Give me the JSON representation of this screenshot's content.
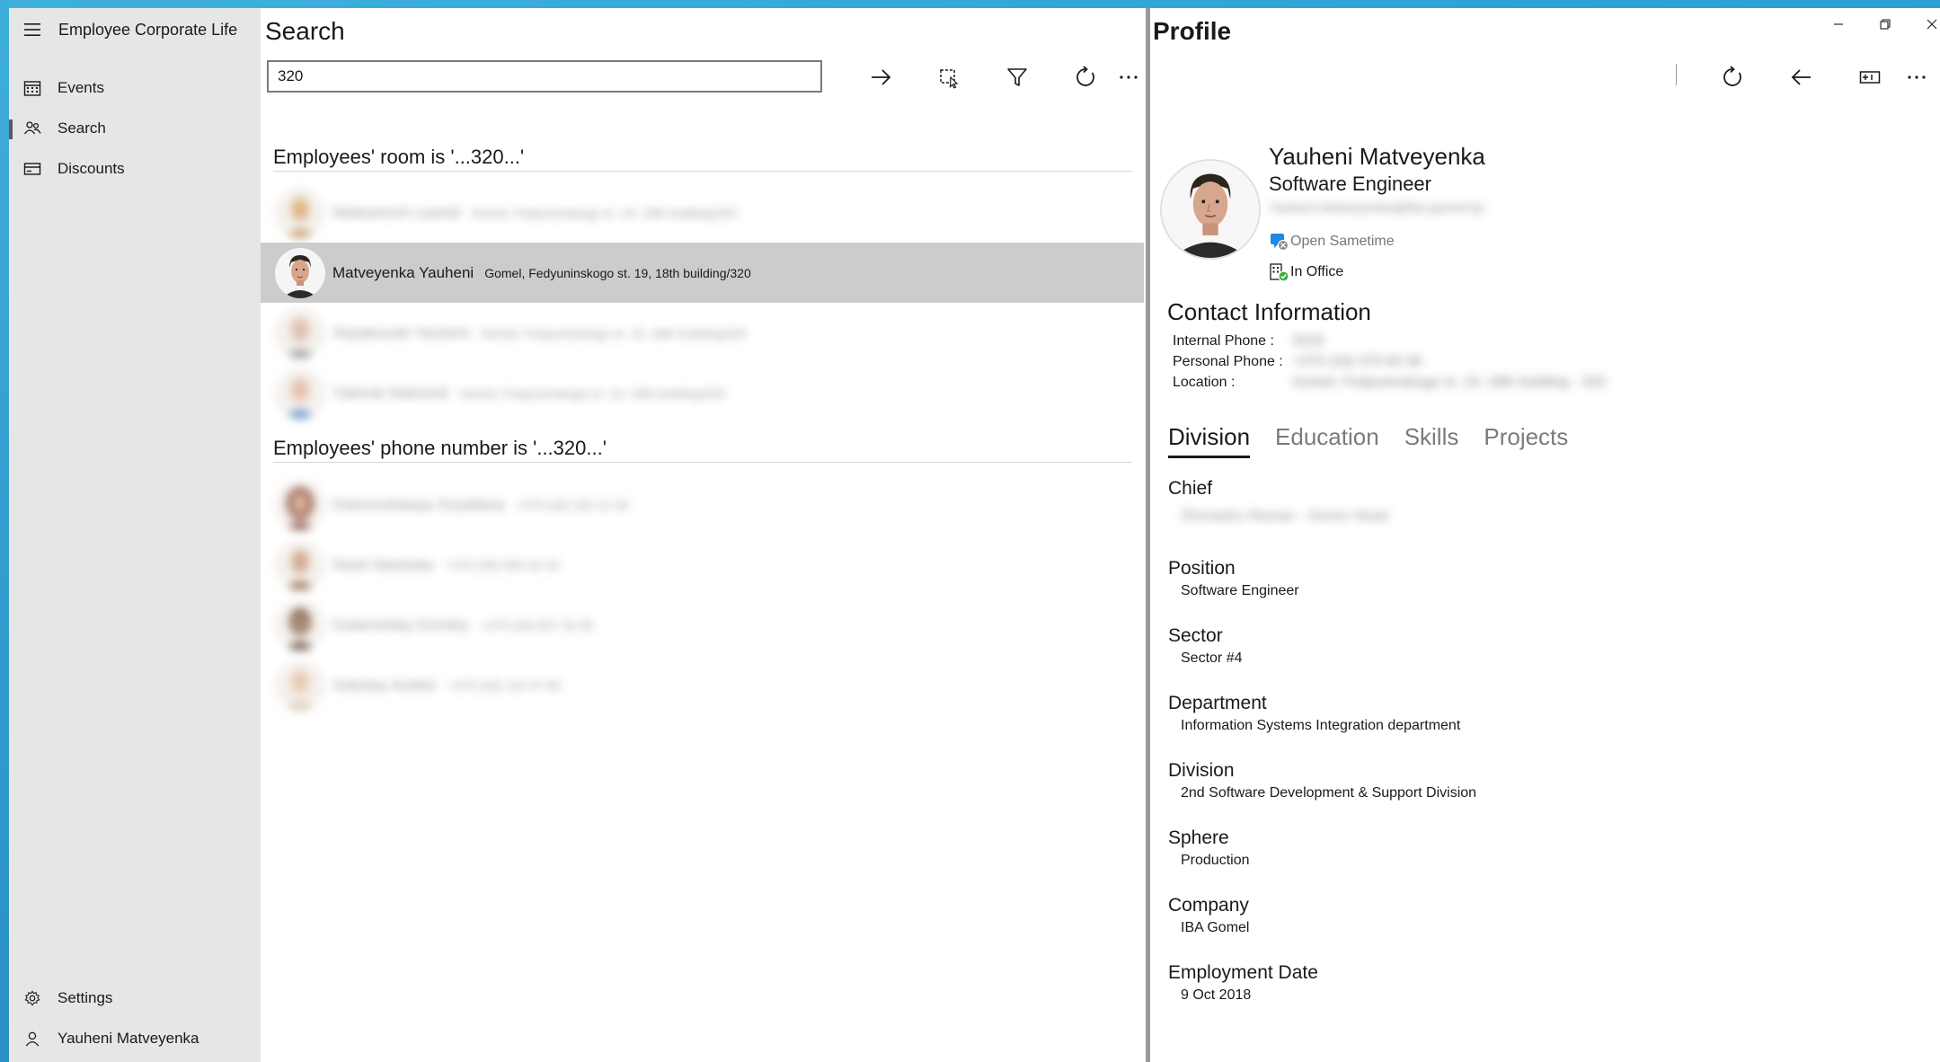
{
  "app": {
    "title": "Employee Corporate Life"
  },
  "nav": {
    "items": [
      {
        "label": "Events",
        "icon": "calendar-icon"
      },
      {
        "label": "Search",
        "icon": "people-icon",
        "selected": true
      },
      {
        "label": "Discounts",
        "icon": "card-icon"
      }
    ],
    "footer": [
      {
        "label": "Settings",
        "icon": "gear-icon"
      },
      {
        "label": "Yauheni Matveyenka",
        "icon": "person-icon"
      }
    ]
  },
  "search": {
    "title": "Search",
    "query": "320",
    "groups": [
      {
        "header": "Employees' room is '...320...'",
        "rows": [
          {
            "name": "Walesevich Leanid",
            "detail": "Gomel, Fedyuninskogo st. 19, 18th building/320",
            "blurred": true,
            "skin": "#d8a56a",
            "shirt": "#c08a50"
          },
          {
            "name": "Matveyenka Yauheni",
            "detail": "Gomel, Fedyuninskogo st. 19, 18th building/320",
            "blurred": false,
            "selected": true,
            "skin": "#d7a68c",
            "shirt": "#2a2a2a"
          },
          {
            "name": "Shpakovski Yauheni",
            "detail": "Gomel, Fedyuninskogo st. 19, 18th building/320",
            "blurred": true,
            "skin": "#d9b19b",
            "shirt": "#8a8a8a"
          },
          {
            "name": "Yakimik Maksimil",
            "detail": "Gomel, Fedyuninskogo st. 19, 18th building/320",
            "blurred": true,
            "skin": "#e0b49a",
            "shirt": "#4c7fc0"
          }
        ]
      },
      {
        "header": "Employees' phone number is  '...320...'",
        "rows": [
          {
            "name": "Dobrovolskaya Svyatlana",
            "detail": "+375 (44) 320 11 00",
            "blurred": true,
            "skin": "#d3a184",
            "shirt": "#7a3a2a"
          },
          {
            "name": "Navit Stanislau",
            "detail": "+375 (29) 555 32 20",
            "blurred": true,
            "skin": "#c99877",
            "shirt": "#8a5a3a"
          },
          {
            "name": "Dubenetsky Dzmitry",
            "detail": "+375 (29) 657 32 05",
            "blurred": true,
            "skin": "#9a7050",
            "shirt": "#5a3a2a"
          },
          {
            "name": "Sobolau Andrei",
            "detail": "+375 (29) 132 07 80",
            "blurred": true,
            "skin": "#e2c09e",
            "shirt": "#d0c0a0"
          }
        ]
      }
    ]
  },
  "profile": {
    "title": "Profile",
    "name": "Yauheni Matveyenka",
    "position": "Software Engineer",
    "email": "Yauheni.Matveyenka@iba-gomel.by",
    "status_chat": "Open Sametime",
    "status_office": "In Office",
    "contact_title": "Contact Information",
    "contact": [
      {
        "label": "Internal Phone :",
        "value": "3220"
      },
      {
        "label": "Personal Phone :",
        "value": "+375 (33) 370 83 36"
      },
      {
        "label": "Location :",
        "value": "Gomel, Fedyuninskogo st. 19, 18th building - 320"
      }
    ],
    "tabs": [
      "Division",
      "Education",
      "Skills",
      "Projects"
    ],
    "active_tab": "Division",
    "fields": [
      {
        "label": "Chief",
        "value": "Zhenadzu Raman - Sector Head",
        "blurred": true
      },
      {
        "label": "Position",
        "value": "Software Engineer"
      },
      {
        "label": "Sector",
        "value": "Sector #4"
      },
      {
        "label": "Department",
        "value": "Information Systems Integration  department"
      },
      {
        "label": "Division",
        "value": "2nd Software Development & Support Division"
      },
      {
        "label": "Sphere",
        "value": "Production"
      },
      {
        "label": "Company",
        "value": "IBA Gomel"
      },
      {
        "label": "Employment Date",
        "value": "9 Oct 2018"
      }
    ]
  },
  "colors": {
    "nav_bg": "#e6e6e6",
    "selected_row": "#cccccc",
    "desktop_accent": "#2aa3d6",
    "status_green": "#3cae3c",
    "sametime_blue": "#1e88e5"
  }
}
